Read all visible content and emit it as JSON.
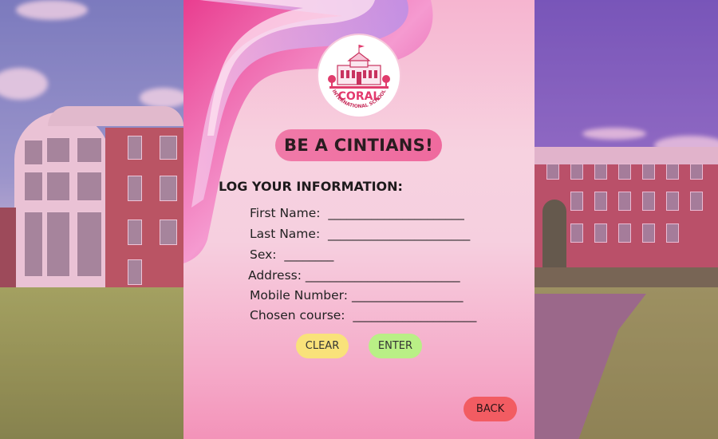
{
  "headline": "BE A CINTIANS!",
  "logo": {
    "name": "CORAL",
    "subtitle": "INTERNATIONAL SCHOOL"
  },
  "form": {
    "section_title": "LOG YOUR INFORMATION:",
    "fields": [
      {
        "label": "First Name:",
        "blank": "______________________"
      },
      {
        "label": "Last Name:",
        "blank": "_______________________"
      },
      {
        "label": "Sex:",
        "blank": "________"
      },
      {
        "label": "Address:",
        "blank": "_________________________"
      },
      {
        "label": "Mobile Number:",
        "blank": "__________________"
      },
      {
        "label": "Chosen course:",
        "blank": "____________________"
      }
    ]
  },
  "buttons": {
    "clear": "CLEAR",
    "enter": "ENTER",
    "back": "BACK"
  },
  "colors": {
    "headline_bg": "#ef6a9e",
    "clear_bg": "#f9e27a",
    "enter_bg": "#b9ef86",
    "back_bg": "#f25c62",
    "panel_pink": "#f6cfdf"
  }
}
